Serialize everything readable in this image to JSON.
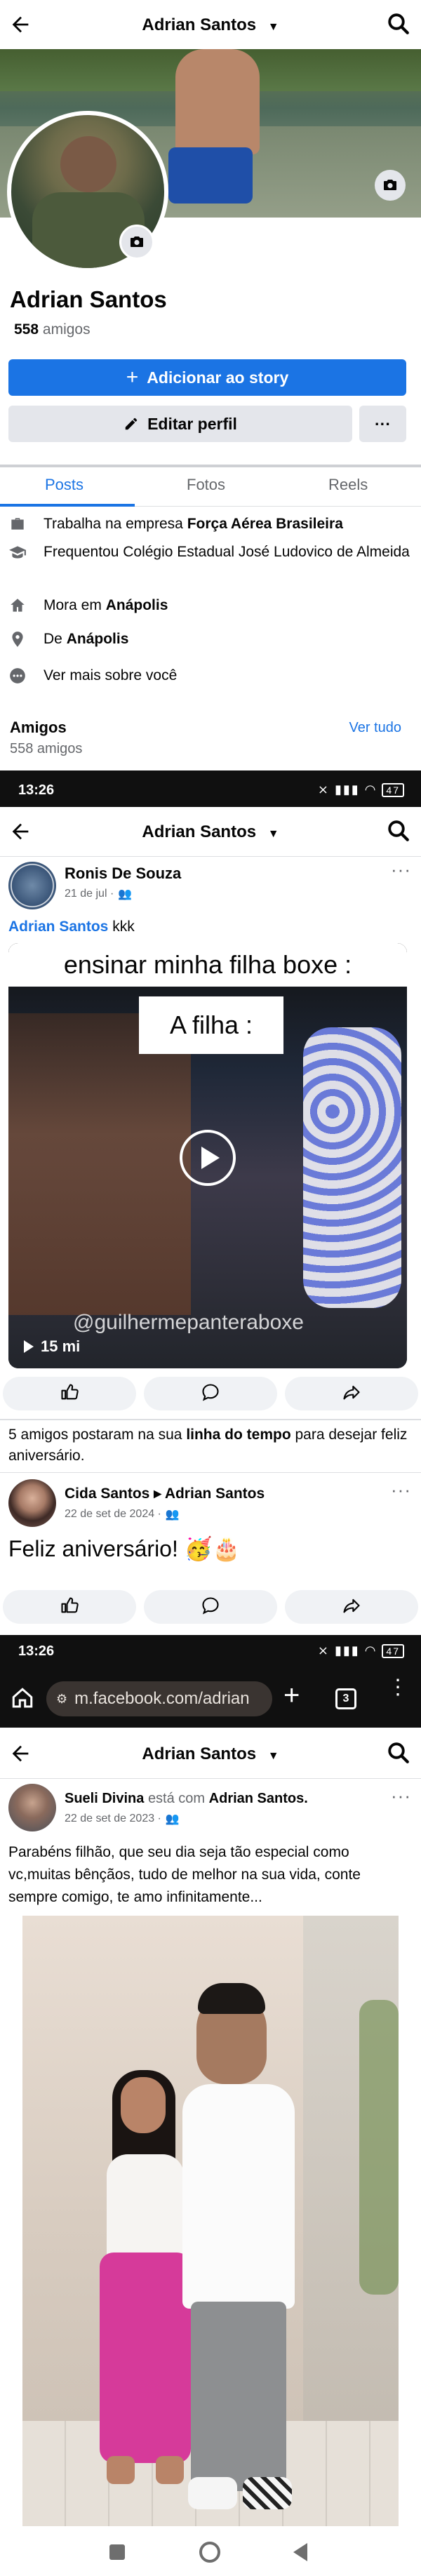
{
  "profile": {
    "name": "Adrian Santos",
    "friend_count": "558",
    "friend_word": "amigos",
    "add_story": "Adicionar ao story",
    "edit_profile": "Editar perfil",
    "more_dots": "···"
  },
  "tabs": [
    "Posts",
    "Fotos",
    "Reels"
  ],
  "about": {
    "work_prefix": "Trabalha na empresa",
    "work_place": "Força Aérea Brasileira",
    "study": "Frequentou Colégio Estadual José Ludovico de Almeida",
    "lives_prefix": "Mora em",
    "lives_place": "Anápolis",
    "from_prefix": "De",
    "from_place": "Anápolis",
    "see_more": "Ver mais sobre você"
  },
  "friends": {
    "title": "Amigos",
    "count": "558 amigos",
    "see_all": "Ver tudo"
  },
  "status": {
    "time": "13:26",
    "battery": "47"
  },
  "browser": {
    "url": "m.facebook.com/adrian",
    "tab_count": "3"
  },
  "post1": {
    "author": "Ronis De Souza",
    "date": "21 de jul ·",
    "tag": "Adrian Santos",
    "text": " kkk",
    "video_caption_top": "ensinar minha filha boxe :",
    "video_caption_mid": "A filha :",
    "video_watermark": "@guilhermepanteraboxe",
    "views": "15 mi"
  },
  "birthday_note": {
    "prefix": "5 amigos postaram na sua",
    "bold": "linha do tempo",
    "suffix": "para desejar feliz aniversário."
  },
  "post2": {
    "author": "Cida Santos",
    "arrow": "▸",
    "target": "Adrian Santos",
    "date": "22 de set de 2024 ·",
    "text": "Feliz aniversário! 🥳🎂"
  },
  "post3": {
    "author": "Sueli Divina",
    "with_word": "está com",
    "target": "Adrian Santos.",
    "date": "22 de set de 2023 ·",
    "text": "Parabéns filhão, que seu dia seja tão especial como vc,muitas bênçãos, tudo de melhor na sua vida, conte sempre comigo, te amo infinitamente..."
  },
  "colors": {
    "accent": "#1b74e4",
    "text": "#050505",
    "muted": "#65676b",
    "button_gray": "#e4e6eb"
  },
  "icons": [
    "back-arrow-icon",
    "chevron-down-icon",
    "search-icon",
    "camera-icon",
    "plus-icon",
    "pencil-icon",
    "briefcase-icon",
    "graduation-cap-icon",
    "home-icon",
    "location-pin-icon",
    "more-dots-icon",
    "globe-icon",
    "friends-icon",
    "like-icon",
    "comment-icon",
    "share-icon",
    "play-icon"
  ]
}
